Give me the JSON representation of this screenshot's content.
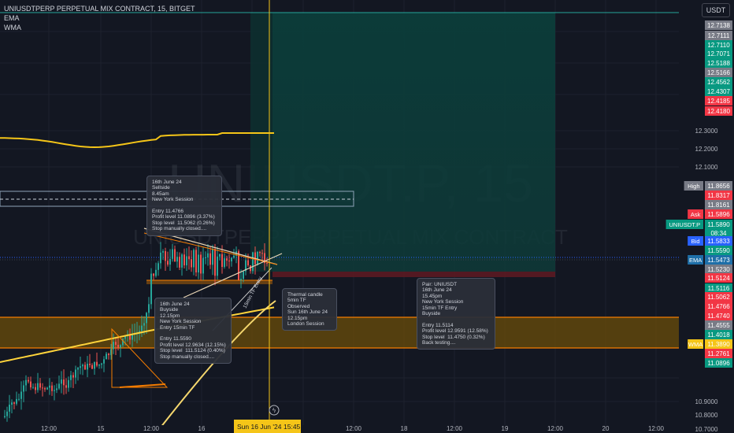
{
  "header": {
    "title": "UNIUSDTPERP PERPETUAL MIX CONTRACT, 15, BITGET",
    "indicators": [
      "EMA",
      "WMA"
    ],
    "currency": "USDT"
  },
  "watermark": {
    "symbol": "UNIUSDT.P, 15",
    "description": "UNIUSDTPERP PERPETUAL MIX CONTRACT"
  },
  "notes": [
    {
      "lines": [
        "16th June 24",
        "Sellside",
        "8.45am",
        "New York Session",
        "",
        "Entry 11.4766",
        "Profit level 11.0896 (3.37%)",
        "Stop level  11.5062 (0.26%)",
        "Stop manually closed...."
      ]
    },
    {
      "lines": [
        "16th June 24",
        "Buyside",
        "12.15pm",
        "New York Session",
        "Entry 15min TF",
        "",
        "Entry 11.5590",
        "Profit level 12.9634 (12.15%)",
        "Stop level  111.5124 (0.40%)",
        "Stop manually closed...."
      ]
    },
    {
      "lines": [
        "Thermal candle",
        "5min TF",
        "Observed",
        "Sun 16th June 24",
        "12.15pm",
        "London Session"
      ]
    },
    {
      "lines": [
        "Pair: UNIUSDT",
        "16th June 24",
        "15.45pm",
        "New York Session",
        "15min TF Entry",
        "Buyside",
        "",
        "Entry 11.5114",
        "Profit level 12.9591 (12.58%)",
        "Stop level  11.4750 (0.32%)",
        "Back testing...."
      ]
    }
  ],
  "trendline_label": "15min TF Entry",
  "chart_data": {
    "type": "candlestick",
    "title": "UNIUSDTPERP PERPETUAL MIX CONTRACT, 15, BITGET",
    "timeframe": "15",
    "exchange": "BITGET",
    "currency": "USDT",
    "y_axis_ticks": [
      "12.3000",
      "12.2000",
      "12.1000",
      "10.9000",
      "10.8000",
      "10.7000"
    ],
    "x_axis_ticks": [
      "12:00",
      "15",
      "12:00",
      "16",
      "12:00",
      "17",
      "12:00",
      "18",
      "12:00",
      "19",
      "12:00",
      "20",
      "12:00"
    ],
    "crosshair": {
      "time": "Sun 16 Jun '24",
      "clock": "15:45",
      "color": "#f5c518"
    },
    "price_labels": [
      {
        "value": "12.7138",
        "color": "#787b86"
      },
      {
        "value": "12.7111",
        "color": "#787b86"
      },
      {
        "value": "12.7110",
        "color": "#089981"
      },
      {
        "value": "12.7071",
        "color": "#089981"
      },
      {
        "value": "12.5188",
        "color": "#089981"
      },
      {
        "value": "12.5166",
        "color": "#787b86"
      },
      {
        "value": "12.4562",
        "color": "#089981"
      },
      {
        "value": "12.4307",
        "color": "#089981"
      },
      {
        "value": "12.4185",
        "color": "#f23645"
      },
      {
        "value": "12.4180",
        "color": "#f23645"
      },
      {
        "value": "11.8656",
        "tag": "High",
        "color": "#787b86"
      },
      {
        "value": "11.8317",
        "color": "#f23645"
      },
      {
        "value": "11.8161",
        "color": "#787b86"
      },
      {
        "value": "11.5896",
        "tag": "Ask",
        "color": "#f23645"
      },
      {
        "value": "11.5890",
        "tag": "UNIUSDT.P",
        "sub": "08:34",
        "color": "#089981"
      },
      {
        "value": "11.5833",
        "tag": "Bid",
        "color": "#2962ff"
      },
      {
        "value": "11.5590",
        "color": "#089981"
      },
      {
        "value": "11.5473",
        "tag": "EMA",
        "color": "#1e6fa8"
      },
      {
        "value": "11.5230",
        "color": "#787b86"
      },
      {
        "value": "11.5124",
        "color": "#f23645"
      },
      {
        "value": "11.5116",
        "color": "#089981"
      },
      {
        "value": "11.5062",
        "color": "#f23645"
      },
      {
        "value": "11.4766",
        "color": "#f23645"
      },
      {
        "value": "11.4740",
        "color": "#f23645"
      },
      {
        "value": "11.4555",
        "color": "#787b86"
      },
      {
        "value": "11.4018",
        "color": "#089981"
      },
      {
        "value": "11.3890",
        "tag": "WMA",
        "color": "#f5c518"
      },
      {
        "value": "11.2761",
        "color": "#f23645"
      },
      {
        "value": "11.0896",
        "color": "#089981"
      }
    ],
    "series": [
      {
        "name": "EMA",
        "color": "#f5c518"
      },
      {
        "name": "WMA",
        "color": "#ff9800"
      }
    ]
  }
}
